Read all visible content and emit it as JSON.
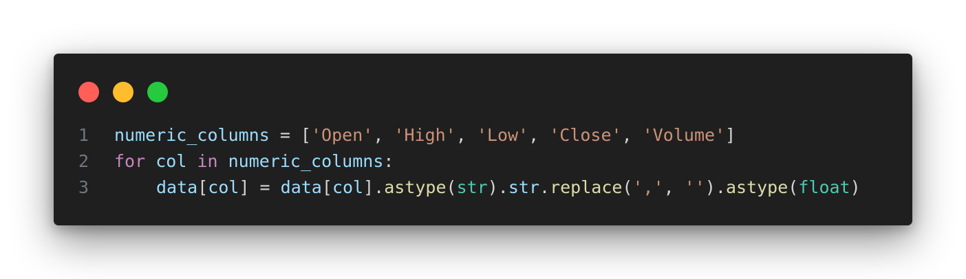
{
  "colors": {
    "window_bg": "#1f1f1f",
    "close_dot": "#ff5f56",
    "minimize_dot": "#ffbd2e",
    "maximize_dot": "#27c93f",
    "line_number": "#6e7681",
    "variable": "#9cdcfe",
    "keyword": "#c586c0",
    "string": "#ce9178",
    "function": "#dcdcaa",
    "builtin_type": "#4ec9b0",
    "punctuation": "#d4d4d4"
  },
  "window_controls": [
    {
      "name": "close",
      "color": "#ff5f56"
    },
    {
      "name": "minimize",
      "color": "#ffbd2e"
    },
    {
      "name": "maximize",
      "color": "#27c93f"
    }
  ],
  "code": {
    "language": "python",
    "lines": [
      {
        "number": "1",
        "indent": false,
        "tokens": [
          {
            "text": "numeric_columns",
            "type": "variable"
          },
          {
            "text": " = [",
            "type": "punctuation"
          },
          {
            "text": "'Open'",
            "type": "string"
          },
          {
            "text": ", ",
            "type": "punctuation"
          },
          {
            "text": "'High'",
            "type": "string"
          },
          {
            "text": ", ",
            "type": "punctuation"
          },
          {
            "text": "'Low'",
            "type": "string"
          },
          {
            "text": ", ",
            "type": "punctuation"
          },
          {
            "text": "'Close'",
            "type": "string"
          },
          {
            "text": ", ",
            "type": "punctuation"
          },
          {
            "text": "'Volume'",
            "type": "string"
          },
          {
            "text": "]",
            "type": "punctuation"
          }
        ]
      },
      {
        "number": "2",
        "indent": false,
        "tokens": [
          {
            "text": "for",
            "type": "keyword"
          },
          {
            "text": " ",
            "type": "punctuation"
          },
          {
            "text": "col",
            "type": "variable"
          },
          {
            "text": " ",
            "type": "punctuation"
          },
          {
            "text": "in",
            "type": "keyword"
          },
          {
            "text": " ",
            "type": "punctuation"
          },
          {
            "text": "numeric_columns",
            "type": "variable"
          },
          {
            "text": ":",
            "type": "punctuation"
          }
        ]
      },
      {
        "number": "3",
        "indent": true,
        "tokens": [
          {
            "text": "data",
            "type": "variable"
          },
          {
            "text": "[",
            "type": "punctuation"
          },
          {
            "text": "col",
            "type": "variable"
          },
          {
            "text": "] = ",
            "type": "punctuation"
          },
          {
            "text": "data",
            "type": "variable"
          },
          {
            "text": "[",
            "type": "punctuation"
          },
          {
            "text": "col",
            "type": "variable"
          },
          {
            "text": "].",
            "type": "punctuation"
          },
          {
            "text": "astype",
            "type": "function"
          },
          {
            "text": "(",
            "type": "punctuation"
          },
          {
            "text": "str",
            "type": "builtin_type"
          },
          {
            "text": ").",
            "type": "punctuation"
          },
          {
            "text": "str",
            "type": "variable"
          },
          {
            "text": ".",
            "type": "punctuation"
          },
          {
            "text": "replace",
            "type": "function"
          },
          {
            "text": "(",
            "type": "punctuation"
          },
          {
            "text": "','",
            "type": "string"
          },
          {
            "text": ", ",
            "type": "punctuation"
          },
          {
            "text": "''",
            "type": "string"
          },
          {
            "text": ").",
            "type": "punctuation"
          },
          {
            "text": "astype",
            "type": "function"
          },
          {
            "text": "(",
            "type": "punctuation"
          },
          {
            "text": "float",
            "type": "builtin_type"
          },
          {
            "text": ")",
            "type": "punctuation"
          }
        ]
      }
    ]
  }
}
